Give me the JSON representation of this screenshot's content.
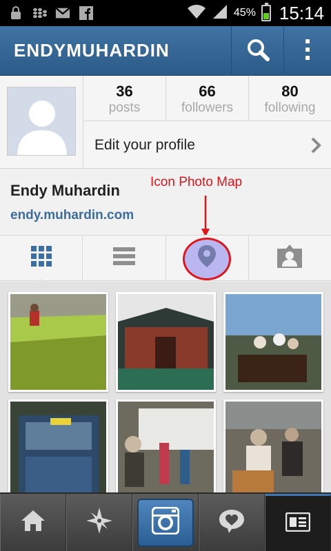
{
  "status_bar": {
    "battery_percent": "45%",
    "battery_level": 0.45,
    "time": "15:14",
    "icons": [
      "lock-icon",
      "blackberry-icon",
      "gmail-icon",
      "facebook-icon",
      "wifi-icon",
      "signal-icon",
      "battery-icon"
    ]
  },
  "header": {
    "username": "ENDYMUHARDIN",
    "search_icon": "search-icon",
    "more_icon": "overflow-menu-icon"
  },
  "profile": {
    "stats": [
      {
        "value": "36",
        "label": "posts"
      },
      {
        "value": "66",
        "label": "followers"
      },
      {
        "value": "80",
        "label": "following"
      }
    ],
    "edit_label": "Edit your profile",
    "full_name": "Endy Muhardin",
    "website": "endy.muhardin.com",
    "annotation": "Icon Photo Map"
  },
  "tabs": [
    {
      "icon": "grid-view-icon",
      "active": true
    },
    {
      "icon": "list-view-icon",
      "active": false
    },
    {
      "icon": "photo-map-icon",
      "active": false
    },
    {
      "icon": "tagged-photos-icon",
      "active": false
    }
  ],
  "bottom_nav": [
    {
      "icon": "home-icon"
    },
    {
      "icon": "explore-icon"
    },
    {
      "icon": "camera-icon"
    },
    {
      "icon": "activity-heart-icon"
    },
    {
      "icon": "profile-news-icon"
    }
  ],
  "colors": {
    "header": "#2f5e8c",
    "link": "#3d6d9b",
    "annotation": "#e0141b",
    "highlight_fill": "#b9b6f0",
    "tab_icon_active": "#3b6ea5"
  }
}
